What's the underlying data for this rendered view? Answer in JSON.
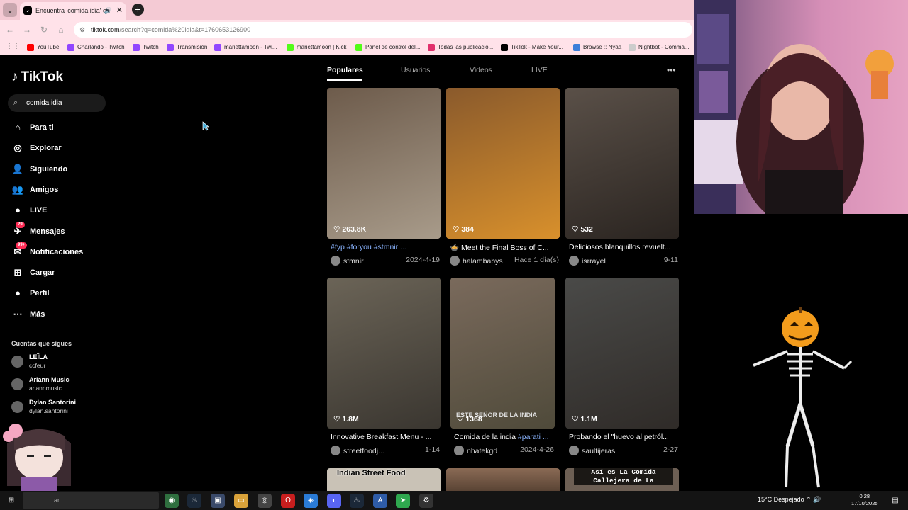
{
  "browser": {
    "tab_title": "Encuentra 'comida idia' en",
    "address": {
      "host": "tiktok.com",
      "path": "/search?q=comida%20idia&t=1760653126900"
    },
    "bookmarks": [
      {
        "label": "YouTube",
        "color": "#ff0000"
      },
      {
        "label": "Charlando - Twitch",
        "color": "#9146ff"
      },
      {
        "label": "Twitch",
        "color": "#9146ff"
      },
      {
        "label": "Transmisión",
        "color": "#9146ff"
      },
      {
        "label": "mariettamoon - Twi...",
        "color": "#9146ff"
      },
      {
        "label": "mariettamoon | Kick",
        "color": "#53fc18"
      },
      {
        "label": "Panel de control del...",
        "color": "#53fc18"
      },
      {
        "label": "Todas las publicacio...",
        "color": "#e1306c"
      },
      {
        "label": "TikTok - Make Your...",
        "color": "#000000"
      },
      {
        "label": "Browse :: Nyaa",
        "color": "#3c7fd9"
      },
      {
        "label": "Nightbot - Comma...",
        "color": "#cccccc"
      }
    ]
  },
  "sidebar": {
    "logo": "TikTok",
    "search_value": "comida idia",
    "nav": [
      {
        "label": "Para ti",
        "icon": "home-icon"
      },
      {
        "label": "Explorar",
        "icon": "compass-icon"
      },
      {
        "label": "Siguiendo",
        "icon": "following-icon"
      },
      {
        "label": "Amigos",
        "icon": "friends-icon"
      },
      {
        "label": "LIVE",
        "icon": "live-icon"
      },
      {
        "label": "Mensajes",
        "icon": "messages-icon",
        "badge": "29"
      },
      {
        "label": "Notificaciones",
        "icon": "notifications-icon",
        "badge": "99+"
      },
      {
        "label": "Cargar",
        "icon": "upload-icon"
      },
      {
        "label": "Perfil",
        "icon": "profile-icon"
      },
      {
        "label": "Más",
        "icon": "more-icon"
      }
    ],
    "following_title": "Cuentas que sigues",
    "accounts": [
      {
        "name": "LEÏLA",
        "handle": "ccfeur"
      },
      {
        "name": "Ariann Music",
        "handle": "ariannmusic",
        "verified": true
      },
      {
        "name": "Dylan Santorini",
        "handle": "dylan.santorini"
      }
    ]
  },
  "tabs": [
    "Populares",
    "Usuarios",
    "Videos",
    "LIVE"
  ],
  "videos": [
    {
      "likes": "263.8K",
      "caption_tag": "#fyp #foryou #stmnir ...",
      "caption": "",
      "user": "stmnir",
      "date": "2024-4-19",
      "colors": [
        "#6d5b4b",
        "#a89b8a"
      ]
    },
    {
      "likes": "384",
      "caption_tag": "",
      "caption": "🍲 Meet the Final Boss of C...",
      "user": "halambabys",
      "date": "Hace 1 día(s)",
      "colors": [
        "#8a5a2c",
        "#d8902c"
      ]
    },
    {
      "likes": "532",
      "caption_tag": "",
      "caption": "Deliciosos blanquillos revuelt...",
      "user": "isrrayel",
      "date": "9-11",
      "colors": [
        "#5a5048",
        "#2a2420"
      ]
    },
    {
      "likes": "1.8M",
      "caption_tag": "",
      "caption": "Innovative Breakfast Menu - ...",
      "user": "streetfoodj...",
      "date": "1-14",
      "colors": [
        "#6b6457",
        "#3a3630"
      ]
    },
    {
      "likes": "1368",
      "caption_tag": "#parati ...",
      "caption": "Comida de la india ",
      "user": "nhatekgd",
      "date": "2024-4-26",
      "colors": [
        "#7a6a5c",
        "#4f4a3a"
      ]
    },
    {
      "likes": "1.1M",
      "caption_tag": "",
      "caption": "Probando el \"huevo al petról...",
      "user": "saultijeras",
      "date": "2-27",
      "colors": [
        "#4a4a48",
        "#2f2b28"
      ]
    }
  ],
  "row3_texts": [
    "Indian Street Food",
    "",
    "Así es La Comida Callejera de La"
  ],
  "video_overlay_text": "ESTE SEÑOR DE LA INDIA",
  "taskbar": {
    "search_placeholder": "ar",
    "weather": "15°C  Despejado",
    "time": "0:28",
    "date": "17/10/2025"
  }
}
